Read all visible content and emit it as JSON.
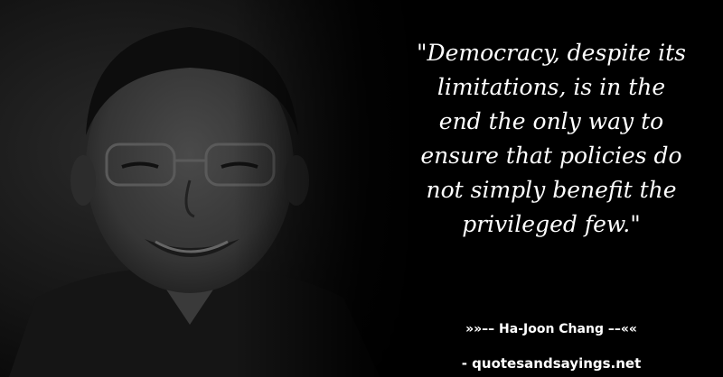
{
  "quote": {
    "lines": [
      "\"Democracy, despite its",
      "limitations, is in the",
      "end the only way to",
      "ensure that policies do",
      "not simply benefit the",
      "privileged few.\""
    ],
    "text_color": "#ffffff"
  },
  "author": {
    "label": "»»–– Ha-Joon Chang ––««"
  },
  "source": {
    "label": "- quotesandsayings.net"
  },
  "colors": {
    "background": "#000000"
  }
}
